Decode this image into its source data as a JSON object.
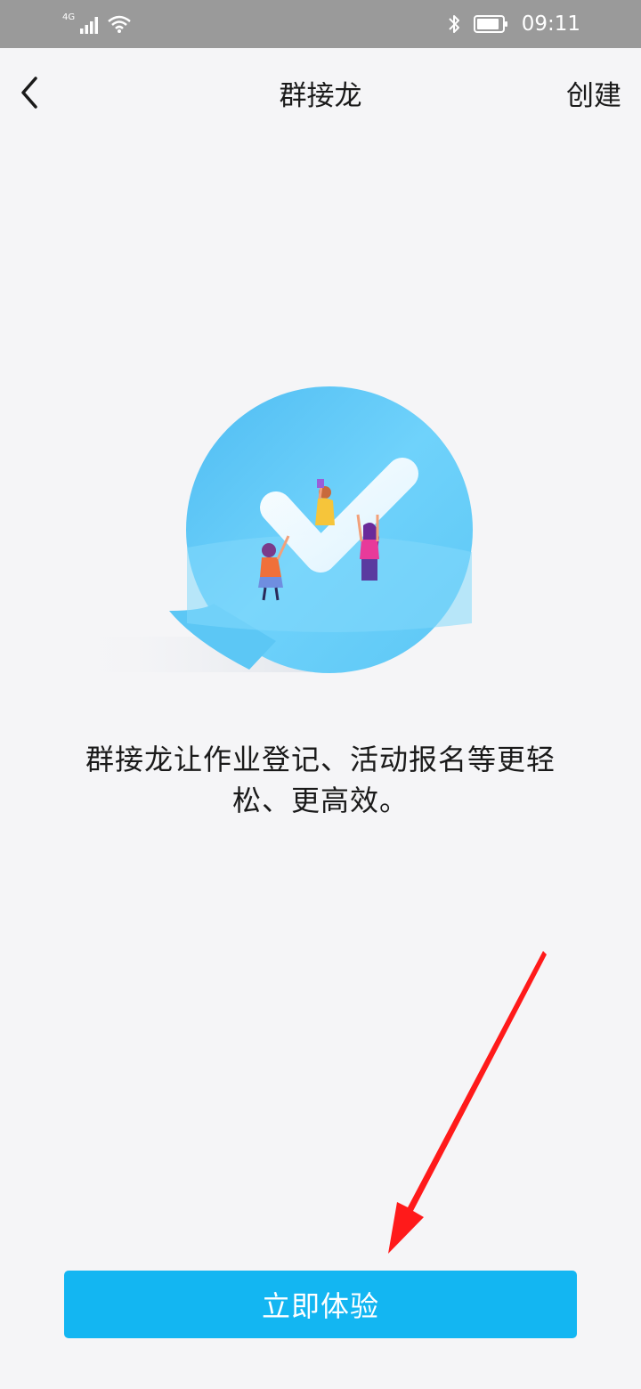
{
  "status_bar": {
    "network": "4G",
    "time": "09:11",
    "icons": [
      "signal-icon",
      "wifi-icon",
      "bluetooth-icon",
      "battery-icon"
    ]
  },
  "nav": {
    "title": "群接龙",
    "action": "创建",
    "back_icon": "chevron-left-icon"
  },
  "hero": {
    "illustration": "speech-bubble-checkmark-people-illustration",
    "bubble_color": "#5cc7f5"
  },
  "description": {
    "line1": "群接龙让作业登记、活动报名等更轻",
    "line2": "松、更高效。"
  },
  "cta": {
    "label": "立即体验",
    "color": "#13b6f2"
  },
  "annotation": {
    "type": "red-arrow-icon",
    "color": "#ff1a1a"
  }
}
